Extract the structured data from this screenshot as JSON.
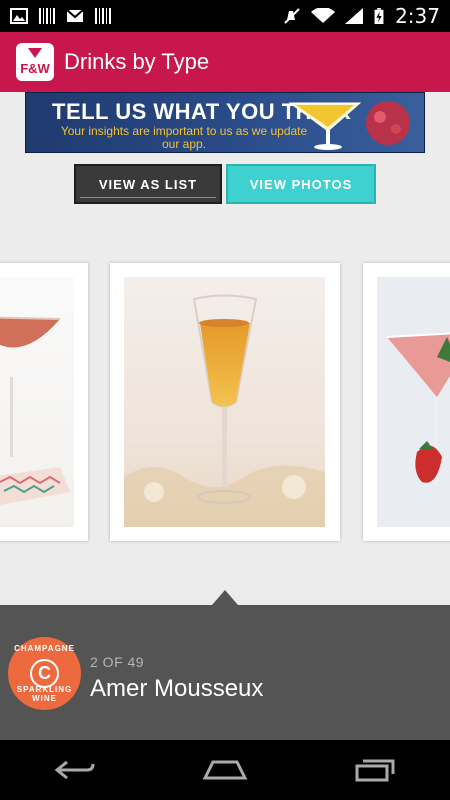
{
  "status_bar": {
    "time": "2:37",
    "icons": [
      "gallery-icon",
      "barcode-icon",
      "gmail-icon",
      "barcode-icon",
      "mute-icon",
      "wifi-icon",
      "signal-icon",
      "battery-charging-icon"
    ]
  },
  "app_bar": {
    "logo_text": "F&W",
    "title": "Drinks by Type",
    "color": "#c8174c"
  },
  "banner": {
    "title": "TELL US WHAT YOU THINK",
    "subtitle": "Your insights are important to us as we update our app."
  },
  "view_toggle": {
    "list_label": "VIEW AS LIST",
    "photos_label": "VIEW PHOTOS",
    "active": "photos",
    "active_color": "#3fd1cf"
  },
  "carousel": {
    "cards": [
      {
        "position": "previous",
        "description": "cocktail coupe"
      },
      {
        "position": "current",
        "description": "champagne flute"
      },
      {
        "position": "next",
        "description": "martini glass with strawberry"
      }
    ]
  },
  "caption": {
    "badge_top": "CHAMPAGNE",
    "badge_letter": "C",
    "badge_bottom": "SPARKLING WINE",
    "counter": "2 OF 49",
    "name": "Amer Mousseux",
    "badge_color": "#ed6a3e"
  },
  "nav_bar": {
    "buttons": [
      "back-icon",
      "home-icon",
      "recents-icon"
    ]
  }
}
